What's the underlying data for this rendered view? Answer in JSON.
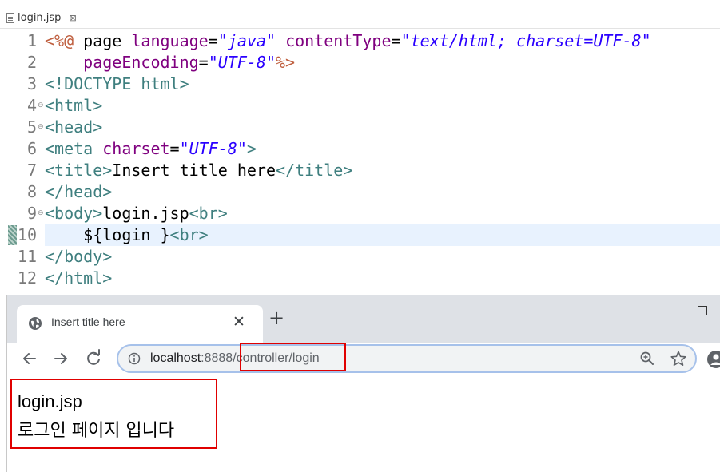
{
  "editor": {
    "tab": {
      "filename": "login.jsp",
      "close_glyph": "⊠"
    },
    "current_line": 10,
    "lines": [
      {
        "number": "1",
        "fold": "",
        "tokens": [
          {
            "t": "<%@ ",
            "c": "jsp"
          },
          {
            "t": "page ",
            "c": "plain"
          },
          {
            "t": "language",
            "c": "attr"
          },
          {
            "t": "=",
            "c": "punct"
          },
          {
            "t": "\"java\"",
            "c": "val"
          },
          {
            "t": " ",
            "c": "plain"
          },
          {
            "t": "contentType",
            "c": "attr"
          },
          {
            "t": "=",
            "c": "punct"
          },
          {
            "t": "\"text/html; charset=UTF-8\"",
            "c": "val"
          }
        ]
      },
      {
        "number": "2",
        "fold": "",
        "tokens": [
          {
            "t": "    ",
            "c": "plain"
          },
          {
            "t": "pageEncoding",
            "c": "attr"
          },
          {
            "t": "=",
            "c": "punct"
          },
          {
            "t": "\"UTF-8\"",
            "c": "val"
          },
          {
            "t": "%>",
            "c": "jsp"
          }
        ]
      },
      {
        "number": "3",
        "fold": "",
        "tokens": [
          {
            "t": "<!DOCTYPE html>",
            "c": "tag"
          }
        ]
      },
      {
        "number": "4",
        "fold": "⊖",
        "tokens": [
          {
            "t": "<html>",
            "c": "tag"
          }
        ]
      },
      {
        "number": "5",
        "fold": "⊖",
        "tokens": [
          {
            "t": "<head>",
            "c": "tag"
          }
        ]
      },
      {
        "number": "6",
        "fold": "",
        "tokens": [
          {
            "t": "<meta ",
            "c": "tag"
          },
          {
            "t": "charset",
            "c": "attr"
          },
          {
            "t": "=",
            "c": "punct"
          },
          {
            "t": "\"UTF-8\"",
            "c": "val"
          },
          {
            "t": ">",
            "c": "tag"
          }
        ]
      },
      {
        "number": "7",
        "fold": "",
        "tokens": [
          {
            "t": "<title>",
            "c": "tag"
          },
          {
            "t": "Insert title here",
            "c": "plain"
          },
          {
            "t": "</title>",
            "c": "tag"
          }
        ]
      },
      {
        "number": "8",
        "fold": "",
        "tokens": [
          {
            "t": "</head>",
            "c": "tag"
          }
        ]
      },
      {
        "number": "9",
        "fold": "⊖",
        "tokens": [
          {
            "t": "<body>",
            "c": "tag"
          },
          {
            "t": "login.jsp",
            "c": "plain"
          },
          {
            "t": "<br>",
            "c": "tag"
          }
        ]
      },
      {
        "number": "10",
        "fold": "",
        "tokens": [
          {
            "t": "    ${login }",
            "c": "plain"
          },
          {
            "t": "<br>",
            "c": "tag"
          }
        ]
      },
      {
        "number": "11",
        "fold": "",
        "tokens": [
          {
            "t": "</body>",
            "c": "tag"
          }
        ]
      },
      {
        "number": "12",
        "fold": "",
        "tokens": [
          {
            "t": "</html>",
            "c": "tag"
          }
        ]
      }
    ]
  },
  "browser": {
    "tab_title": "Insert title here",
    "tab_close": "✕",
    "new_tab": "+",
    "icons": {
      "back": "arrow-left-icon",
      "forward": "arrow-right-icon",
      "reload": "reload-icon",
      "info": "info-circle-icon",
      "zoom": "zoom-icon",
      "bookmark": "star-icon",
      "profile": "profile-icon",
      "tab_favicon": "globe-icon"
    },
    "url": {
      "host": "localhost",
      "port": ":8888",
      "path": "/controller/login"
    },
    "page": {
      "line1": "login.jsp",
      "line2": "로그인 페이지 입니다"
    }
  },
  "colors": {
    "highlight": "#e00000",
    "jsp_delimiter": "#bf5f3f",
    "attribute": "#7f007f",
    "string": "#2a00ff",
    "tag": "#3f7f7f",
    "current_line_bg": "#e8f2fe"
  }
}
